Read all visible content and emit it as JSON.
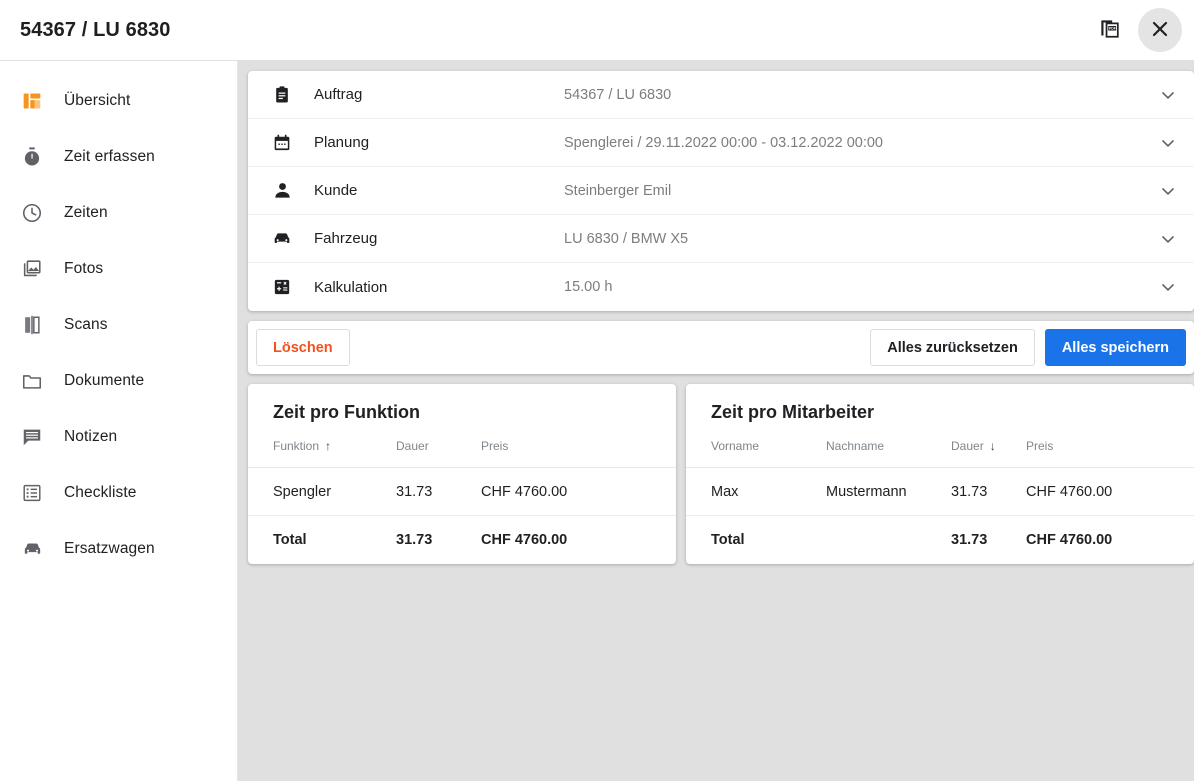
{
  "header": {
    "title": "54367 / LU 6830",
    "pdf_icon": "pdf-icon",
    "close_icon": "close-icon"
  },
  "sidebar": {
    "items": [
      {
        "label": "Übersicht",
        "icon": "dashboard-icon",
        "active": true
      },
      {
        "label": "Zeit erfassen",
        "icon": "stopwatch-icon",
        "active": false
      },
      {
        "label": "Zeiten",
        "icon": "clock-icon",
        "active": false
      },
      {
        "label": "Fotos",
        "icon": "photos-icon",
        "active": false
      },
      {
        "label": "Scans",
        "icon": "scans-icon",
        "active": false
      },
      {
        "label": "Dokumente",
        "icon": "folder-icon",
        "active": false
      },
      {
        "label": "Notizen",
        "icon": "notes-icon",
        "active": false
      },
      {
        "label": "Checkliste",
        "icon": "checklist-icon",
        "active": false
      },
      {
        "label": "Ersatzwagen",
        "icon": "car-icon",
        "active": false
      }
    ]
  },
  "accordion": {
    "rows": [
      {
        "icon": "clipboard-icon",
        "label": "Auftrag",
        "value": "54367 / LU 6830"
      },
      {
        "icon": "calendar-icon",
        "label": "Planung",
        "value": "Spenglerei / 29.11.2022 00:00 - 03.12.2022 00:00"
      },
      {
        "icon": "person-icon",
        "label": "Kunde",
        "value": "Steinberger Emil"
      },
      {
        "icon": "car-icon",
        "label": "Fahrzeug",
        "value": "LU 6830 / BMW X5"
      },
      {
        "icon": "calculator-icon",
        "label": "Kalkulation",
        "value": "15.00 h"
      }
    ],
    "chevron_icon": "chevron-down-icon"
  },
  "actions": {
    "delete_label": "Löschen",
    "reset_label": "Alles zurücksetzen",
    "save_label": "Alles speichern"
  },
  "tables": {
    "function_table": {
      "title": "Zeit pro Funktion",
      "columns": [
        "Funktion",
        "Dauer",
        "Preis"
      ],
      "sort_column": "Funktion",
      "sort_direction": "↑",
      "rows": [
        {
          "funktion": "Spengler",
          "dauer": "31.73",
          "preis": "CHF 4760.00"
        }
      ],
      "total": {
        "label": "Total",
        "dauer": "31.73",
        "preis": "CHF 4760.00"
      }
    },
    "employee_table": {
      "title": "Zeit pro Mitarbeiter",
      "columns": [
        "Vorname",
        "Nachname",
        "Dauer",
        "Preis"
      ],
      "sort_column": "Dauer",
      "sort_direction": "↓",
      "rows": [
        {
          "vorname": "Max",
          "nachname": "Mustermann",
          "dauer": "31.73",
          "preis": "CHF 4760.00"
        }
      ],
      "total": {
        "label": "Total",
        "nachname": "",
        "dauer": "31.73",
        "preis": "CHF 4760.00"
      }
    }
  },
  "colors": {
    "accent_orange": "#f7941d",
    "danger": "#f4511e",
    "primary_blue": "#1a73e8",
    "content_bg": "#e0e0e0"
  }
}
